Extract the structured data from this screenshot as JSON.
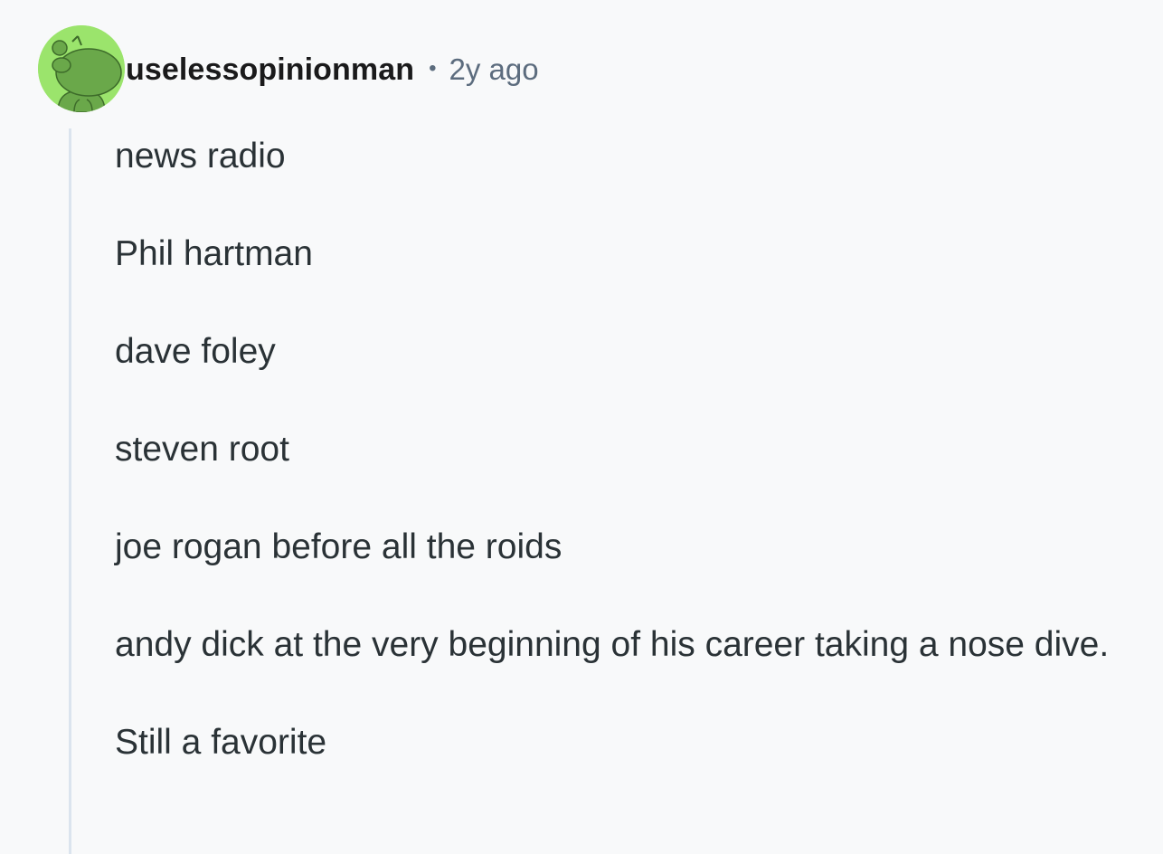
{
  "comment": {
    "username": "uselessopinionman",
    "separator": "•",
    "timestamp": "2y ago",
    "avatar_icon": "snoo-avatar-icon",
    "avatar_bg_color": "#9be46c",
    "paragraphs": [
      "news radio",
      "Phil hartman",
      "dave foley",
      "steven root",
      "joe rogan before all the roids",
      "andy dick at the very beginning of his career taking a nose dive.",
      "Still a favorite"
    ]
  }
}
